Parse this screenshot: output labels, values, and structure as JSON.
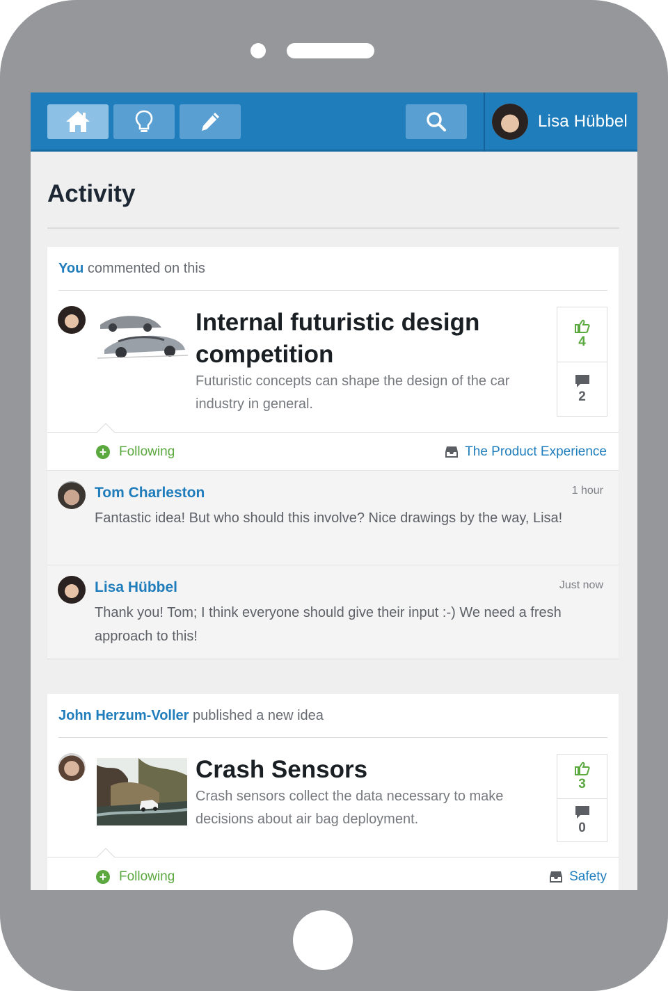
{
  "topbar": {
    "nav": [
      {
        "icon": "home-icon",
        "active": true
      },
      {
        "icon": "lightbulb-icon",
        "active": false
      },
      {
        "icon": "pencil-icon",
        "active": false
      }
    ],
    "search_icon": "search-icon",
    "user_name": "Lisa Hübbel"
  },
  "page": {
    "title": "Activity"
  },
  "feed": [
    {
      "actor": "You",
      "action": "commented on this",
      "idea": {
        "title": "Internal futuristic design competition",
        "description": "Futuristic concepts can shape the design of the car industry in general.",
        "likes": "4",
        "comments": "2"
      },
      "following_label": "Following",
      "channel": "The Product Experience",
      "comments": [
        {
          "name": "Tom Charleston",
          "time": "1 hour",
          "text": "Fantastic idea! But who should this involve? Nice drawings by the way, Lisa!"
        },
        {
          "name": "Lisa Hübbel",
          "time": "Just now",
          "text": "Thank you! Tom; I think everyone should give their input :-) We need a fresh approach to this!"
        }
      ]
    },
    {
      "actor": "John Herzum-Voller",
      "action": "published a new idea",
      "idea": {
        "title": "Crash Sensors",
        "description": "Crash sensors collect the data necessary to make decisions about air bag deployment.",
        "likes": "3",
        "comments": "0"
      },
      "following_label": "Following",
      "channel": "Safety"
    }
  ],
  "colors": {
    "brand": "#1f7dbc",
    "accent_green": "#5ba83f",
    "device": "#96979b"
  }
}
